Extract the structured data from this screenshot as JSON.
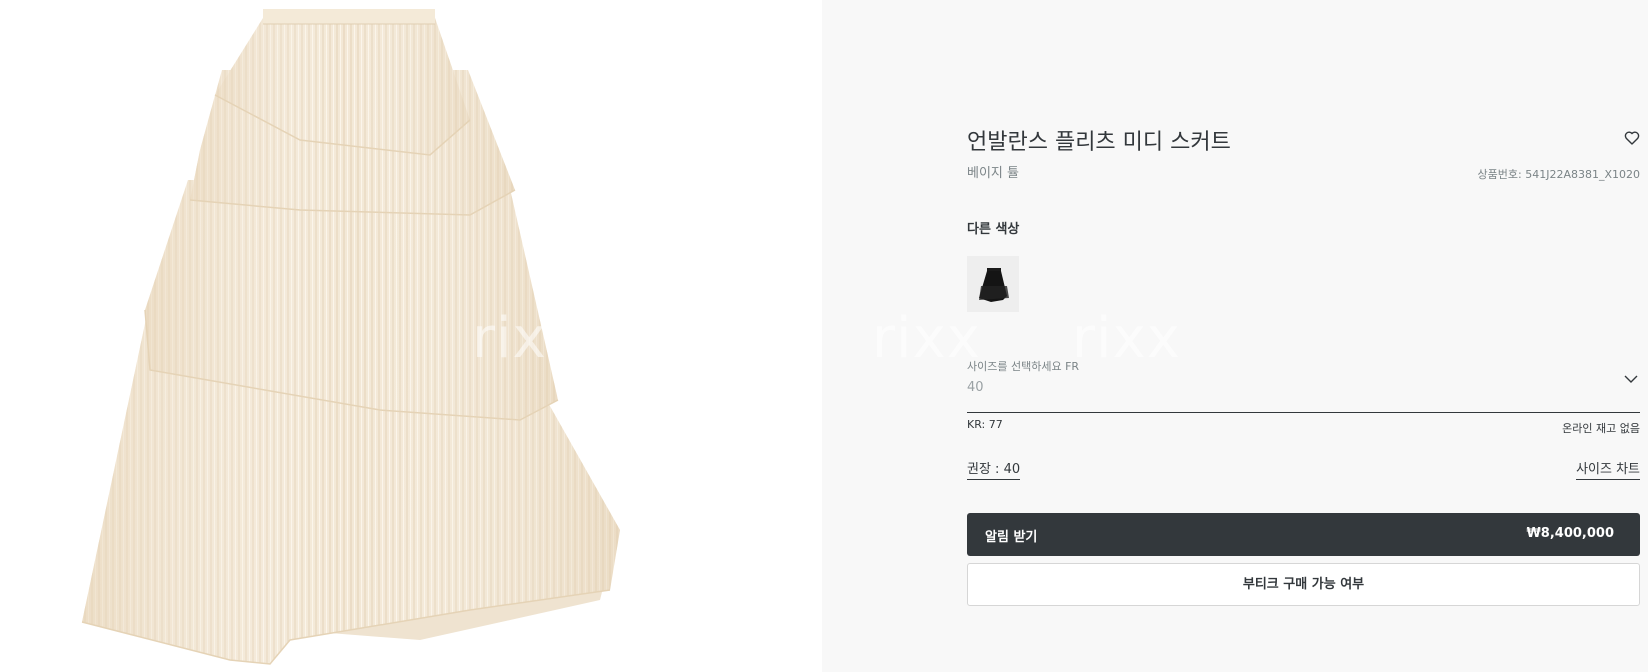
{
  "product": {
    "title": "언발란스 플리츠 미디 스커트",
    "color_name": "베이지 튤",
    "reference": "상품번호: 541J22A8381_X1020",
    "image_icon": "pleated-tulle-skirt-image",
    "wishlist_icon": "heart-icon"
  },
  "other_colors": {
    "label": "다른 색상",
    "swatch_icon": "black-skirt-thumbnail"
  },
  "size": {
    "label": "사이즈를 선택하세요 FR",
    "value": "40",
    "dropdown_icon": "chevron-down-icon",
    "kr_size": "KR: 77",
    "stock_status": "온라인 재고 없음",
    "recommend": "권장 : 40",
    "size_chart": "사이즈 차트"
  },
  "actions": {
    "notify_label": "알림 받기",
    "price": "₩8,400,000",
    "boutique_label": "부티크 구매 가능 여부"
  },
  "watermark": {
    "text": "rixx"
  },
  "colors": {
    "page_bg": "#f8f8f8",
    "image_bg": "#ffffff",
    "primary_button": "#33383c",
    "text_muted": "#7b8487",
    "skirt_tulle": "#f1e4cf"
  }
}
